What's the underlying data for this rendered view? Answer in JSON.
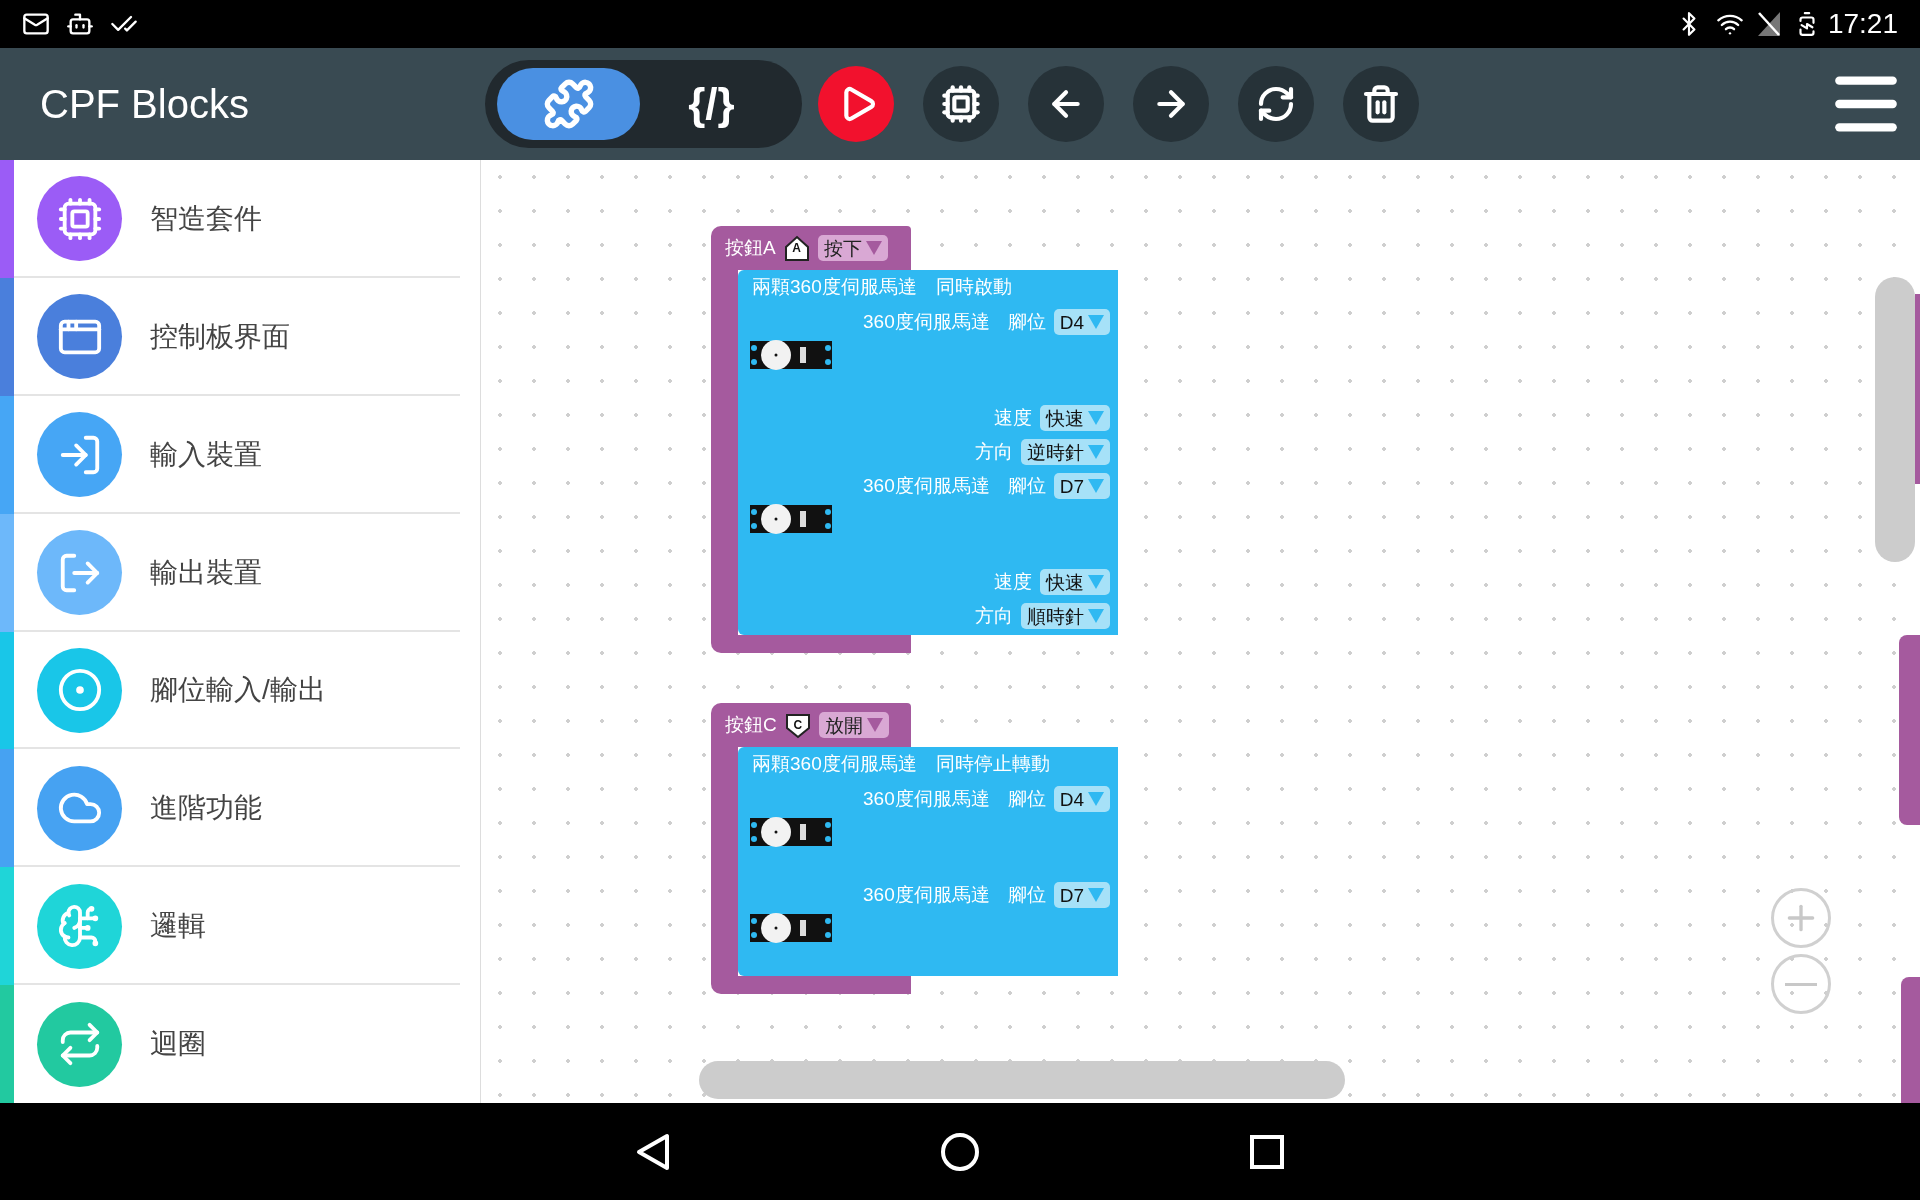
{
  "status_bar": {
    "time": "17:21"
  },
  "app_bar": {
    "title": "CPF Blocks",
    "view_modes": [
      {
        "kind": "blocks",
        "selected": true
      },
      {
        "kind": "code",
        "label": "{/}",
        "selected": false
      }
    ]
  },
  "sidebar": {
    "items": [
      {
        "label": "智造套件",
        "color": "#9b5cf6"
      },
      {
        "label": "控制板界面",
        "color": "#4a7fdc"
      },
      {
        "label": "輸入裝置",
        "color": "#46a6f5"
      },
      {
        "label": "輸出裝置",
        "color": "#6db8fa"
      },
      {
        "label": "腳位輸入/輸出",
        "color": "#19c6e8"
      },
      {
        "label": "進階功能",
        "color": "#46a2f2"
      },
      {
        "label": "邏輯",
        "color": "#1fd5d8"
      },
      {
        "label": "迴圈",
        "color": "#22c9a0"
      }
    ]
  },
  "blocks": [
    {
      "label": "按鈕A",
      "badge": {
        "kind": "house",
        "letter": "A"
      },
      "event": "按下",
      "title": "兩顆360度伺服馬達　同時啟動",
      "motors": [
        {
          "label": "360度伺服馬達",
          "pin_label": "腳位",
          "pin": "D4",
          "fields": [
            {
              "label": "速度",
              "value": "快速"
            },
            {
              "label": "方向",
              "value": "逆時針"
            }
          ]
        },
        {
          "label": "360度伺服馬達",
          "pin_label": "腳位",
          "pin": "D7",
          "fields": [
            {
              "label": "速度",
              "value": "快速"
            },
            {
              "label": "方向",
              "value": "順時針"
            }
          ]
        }
      ]
    },
    {
      "label": "按鈕C",
      "badge": {
        "kind": "shield",
        "letter": "C"
      },
      "event": "放開",
      "title": "兩顆360度伺服馬達　同時停止轉動",
      "motors": [
        {
          "label": "360度伺服馬達",
          "pin_label": "腳位",
          "pin": "D4"
        },
        {
          "label": "360度伺服馬達",
          "pin_label": "腳位",
          "pin": "D7"
        }
      ]
    }
  ]
}
